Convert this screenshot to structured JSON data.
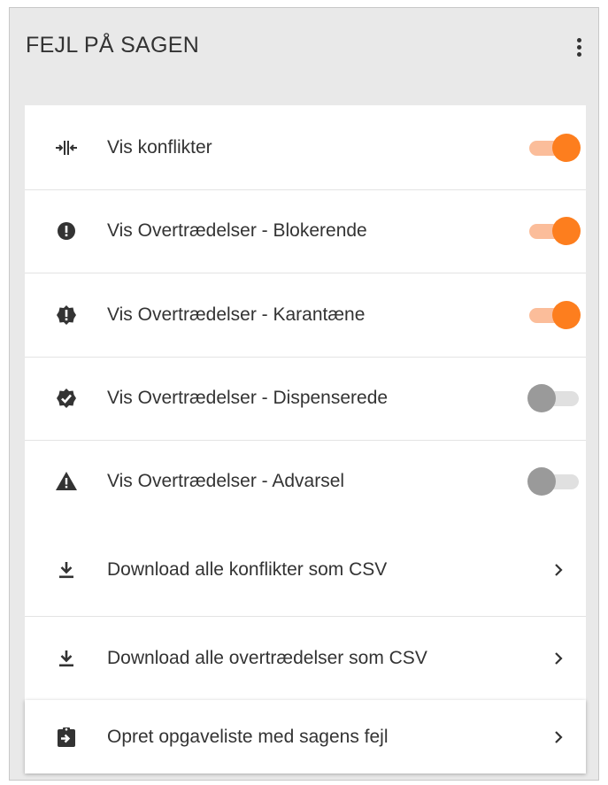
{
  "panel": {
    "title": "FEJL PÅ SAGEN",
    "menu_icon": "more-vert-icon"
  },
  "toggles": [
    {
      "label": "Vis konflikter",
      "icon": "conflict-split-icon",
      "on": true
    },
    {
      "label": "Vis Overtrædelser - Blokerende",
      "icon": "error-circle-icon",
      "on": true
    },
    {
      "label": "Vis Overtrædelser - Karantæne",
      "icon": "error-badge-icon",
      "on": true
    },
    {
      "label": "Vis Overtrædelser - Dispenserede",
      "icon": "verified-badge-icon",
      "on": false
    },
    {
      "label": "Vis Overtrædelser - Advarsel",
      "icon": "warning-triangle-icon",
      "on": false
    }
  ],
  "actions": [
    {
      "label": "Download alle konflikter som CSV",
      "icon": "download-icon"
    },
    {
      "label": "Download alle overtrædelser som CSV",
      "icon": "download-icon"
    }
  ],
  "task_action": {
    "label": "Opret opgaveliste med sagens fejl",
    "icon": "clipboard-arrow-icon"
  },
  "colors": {
    "toggle_on_thumb": "#fd7e1e",
    "toggle_on_track": "#fbbd9a",
    "toggle_off_thumb": "#9a9a9a",
    "toggle_off_track": "#e0e0e0",
    "panel_background": "#e9e9e9"
  }
}
